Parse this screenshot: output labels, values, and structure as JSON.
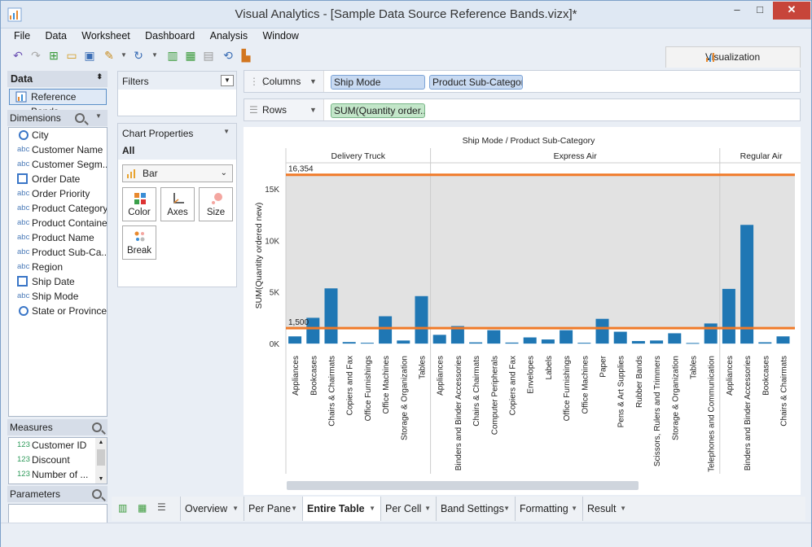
{
  "window": {
    "title": "Visual Analytics - [Sample Data Source Reference Bands.vizx]*",
    "min": "–",
    "max": "□",
    "close": "✕"
  },
  "menu": [
    "File",
    "Data",
    "Worksheet",
    "Dashboard",
    "Analysis",
    "Window"
  ],
  "visualization_tab": "Visualization",
  "data_panel": {
    "header": "Data",
    "datasource": "Reference Bands",
    "dimensions_label": "Dimensions",
    "dimensions": [
      {
        "label": "City",
        "type": "geo"
      },
      {
        "label": "Customer Name",
        "type": "abc"
      },
      {
        "label": "Customer Segm...",
        "type": "abc"
      },
      {
        "label": "Order Date",
        "type": "date"
      },
      {
        "label": "Order Priority",
        "type": "abc"
      },
      {
        "label": "Product Category",
        "type": "abc"
      },
      {
        "label": "Product Container",
        "type": "abc"
      },
      {
        "label": "Product Name",
        "type": "abc"
      },
      {
        "label": "Product Sub-Ca...",
        "type": "abc"
      },
      {
        "label": "Region",
        "type": "abc"
      },
      {
        "label": "Ship Date",
        "type": "date"
      },
      {
        "label": "Ship Mode",
        "type": "abc"
      },
      {
        "label": "State or Province",
        "type": "geo"
      }
    ],
    "measures_label": "Measures",
    "measures": [
      {
        "label": "Customer ID",
        "type": "123"
      },
      {
        "label": "Discount",
        "type": "123"
      },
      {
        "label": "Number of ...",
        "type": "123"
      }
    ],
    "parameters_label": "Parameters"
  },
  "filters": {
    "label": "Filters"
  },
  "chart_properties": {
    "label": "Chart Properties",
    "scope": "All",
    "mark_type": "Bar",
    "buttons": [
      "Color",
      "Axes",
      "Size",
      "Break"
    ]
  },
  "shelves": {
    "columns_label": "Columns",
    "rows_label": "Rows",
    "columns_pills": [
      "Ship Mode",
      "Product Sub-Category"
    ],
    "rows_pills": [
      "SUM(Quantity order..."
    ]
  },
  "chart_data": {
    "type": "bar",
    "title": "Ship Mode / Product Sub-Category",
    "ylabel": "SUM(Quantity ordered new)",
    "ylim": [
      -700,
      17200
    ],
    "yticks": [
      0,
      5000,
      10000,
      15000
    ],
    "ytick_labels": [
      "0K",
      "5K",
      "10K",
      "15K"
    ],
    "reference_lines": [
      {
        "value": 16354,
        "label": "16,354"
      },
      {
        "value": 1500,
        "label": "1,500"
      }
    ],
    "band": {
      "from": 1500,
      "to": 16354
    },
    "panes": [
      {
        "name": "Delivery Truck",
        "categories": [
          "Appliances",
          "Bookcases",
          "Chairs & Chairmats",
          "Copiers and Fax",
          "Office Furnishings",
          "Office Machines",
          "Storage & Organization",
          "Tables"
        ],
        "values": [
          700,
          2500,
          5350,
          150,
          80,
          2650,
          300,
          4600
        ]
      },
      {
        "name": "Express Air",
        "categories": [
          "Appliances",
          "Binders and Binder Accessories",
          "Chairs & Chairmats",
          "Computer Peripherals",
          "Copiers and Fax",
          "Envelopes",
          "Labels",
          "Office Furnishings",
          "Office Machines",
          "Paper",
          "Pens & Art Supplies",
          "Rubber Bands",
          "Scissors, Rulers and Trimmers",
          "Storage & Organization",
          "Tables",
          "Telephones and Communication"
        ],
        "values": [
          850,
          1700,
          120,
          1300,
          100,
          600,
          400,
          1300,
          80,
          2400,
          1150,
          250,
          300,
          1000,
          60,
          1950
        ]
      },
      {
        "name": "Regular Air",
        "categories": [
          "Appliances",
          "Binders and Binder Accessories",
          "Bookcases",
          "Chairs & Chairmats"
        ],
        "values": [
          5300,
          11500,
          130,
          700
        ]
      }
    ],
    "bar_color": "#1f77b4",
    "ref_line_color": "#f07a28"
  },
  "sheet_tabs": [
    {
      "label": "Overview",
      "active": false
    },
    {
      "label": "Per Pane",
      "active": false
    },
    {
      "label": "Entire Table",
      "active": true
    },
    {
      "label": "Per Cell",
      "active": false
    },
    {
      "label": "Band Settings",
      "active": false
    },
    {
      "label": "Formatting",
      "active": false
    },
    {
      "label": "Result",
      "active": false
    }
  ]
}
